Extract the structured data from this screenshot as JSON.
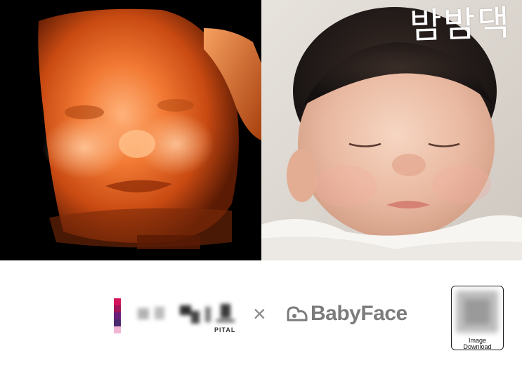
{
  "photos": {
    "left_panel": {
      "icon": "ultrasound-face-image"
    },
    "right_panel": {
      "icon": "newborn-baby-image",
      "overlay_title": "밤밤댁"
    }
  },
  "footer": {
    "hospital_logo": {
      "subtitle_fragment": "PITAL",
      "brand_colors": [
        "#d4145a",
        "#a0145a",
        "#6a1f7a",
        "#4a2a6e",
        "#f2b5d4"
      ]
    },
    "separator": "×",
    "partner_logo": {
      "text": "BabyFace",
      "color": "#7c7c7c",
      "icon": "babyface-mark-icon"
    },
    "download": {
      "label_line1": "Image",
      "label_line2": "Download",
      "icon": "qr-code-icon"
    }
  }
}
